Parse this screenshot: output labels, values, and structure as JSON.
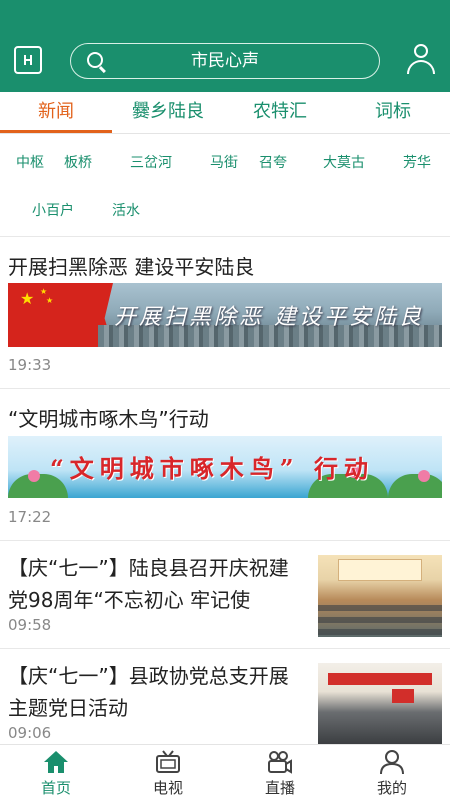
{
  "header": {
    "search_text": "市民心声",
    "icons": {
      "menu": "menu-icon",
      "search": "search-icon",
      "user": "user-icon"
    },
    "brand_color": "#1a8f6d"
  },
  "tabs": [
    {
      "label": "新闻",
      "active": true
    },
    {
      "label": "爨乡陆良",
      "active": false
    },
    {
      "label": "农特汇",
      "active": false
    },
    {
      "label": "词标",
      "active": false
    }
  ],
  "subcategories": [
    "中枢",
    "板桥",
    "三岔河",
    "马街",
    "召夸",
    "大莫古",
    "芳华",
    "小百户",
    "活水"
  ],
  "news": [
    {
      "title": "开展扫黑除恶  建设平安陆良",
      "banner_text": "开展扫黑除恶  建设平安陆良",
      "time": "19:33"
    },
    {
      "title": "“文明城市啄木鸟”行动",
      "banner_text": "“文明城市啄木鸟” 行动",
      "time": "17:22"
    },
    {
      "title": "【庆“七一”】陆良县召开庆祝建党98周年“不忘初心 牢记使",
      "time": "09:58"
    },
    {
      "title": "【庆“七一”】县政协党总支开展主题党日活动",
      "time": "09:06"
    }
  ],
  "bottom_nav": [
    {
      "label": "首页",
      "icon": "home-icon",
      "active": true
    },
    {
      "label": "电视",
      "icon": "tv-icon",
      "active": false
    },
    {
      "label": "直播",
      "icon": "live-camera-icon",
      "active": false
    },
    {
      "label": "我的",
      "icon": "profile-icon",
      "active": false
    }
  ],
  "colors": {
    "accent": "#1a8f6d",
    "active_tab": "#e2621b"
  }
}
